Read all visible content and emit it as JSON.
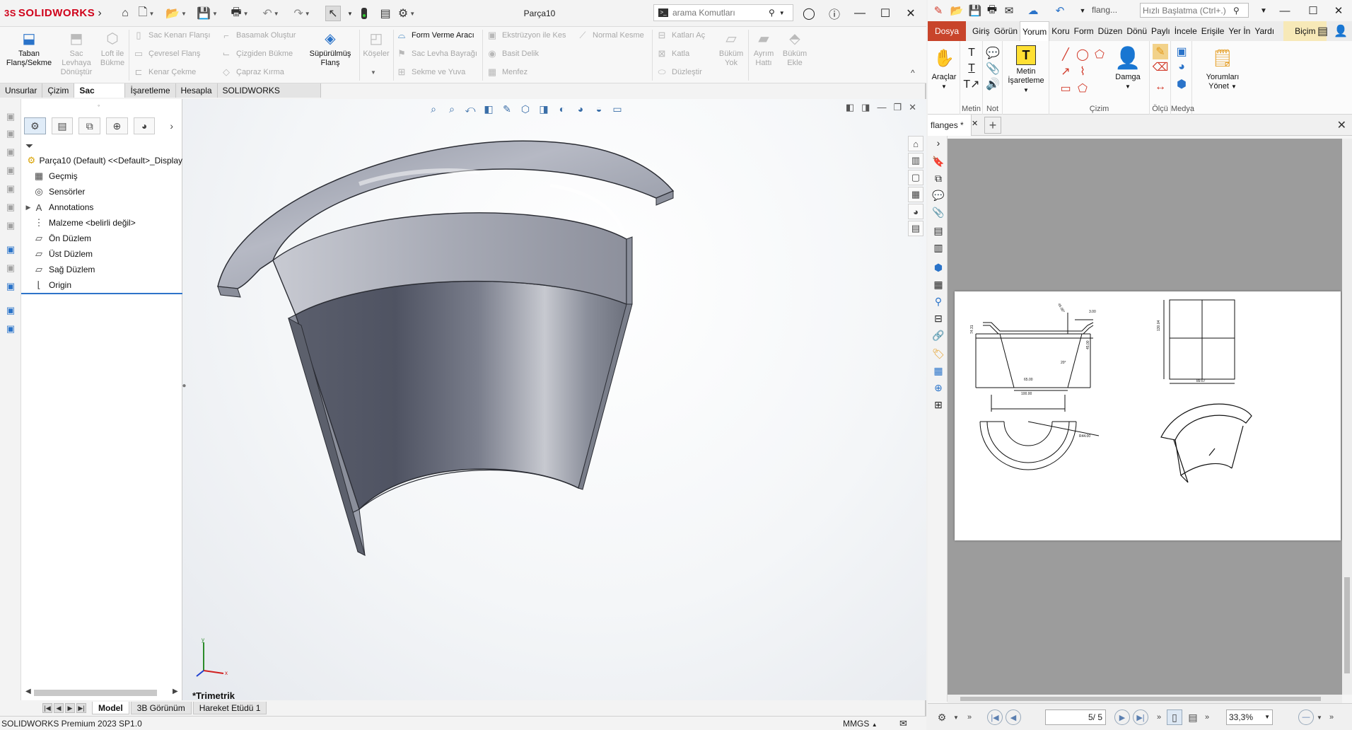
{
  "sw": {
    "logo": "SOLIDWORKS",
    "logo_mark": "3S",
    "doc_title": "Parça10",
    "search_placeholder": "arama Komutları",
    "ribbon": {
      "base_flange": "Taban Flanş/Sekme",
      "sheet_metal": "Sac Levhaya Dönüştür",
      "lofted_bend": "Loft ile Bükme",
      "edge_flange": "Sac Kenarı Flanşı",
      "miter_flange": "Çevresel Flanş",
      "hem": "Kenar Çekme",
      "jog": "Basamak Oluştur",
      "sketched_bend": "Çizgiden Bükme",
      "cross_break": "Çapraz Kırma",
      "swept_flange": "Süpürülmüş Flanş",
      "corners": "Köşeler",
      "forming_tool": "Form Verme Aracı",
      "tab_slot": "Sac Levha Bayrağı",
      "vent": "Sekme ve Yuva",
      "extruded_cut": "Ekstrüzyon ile Kes",
      "simple_hole": "Basit Delik",
      "vent2": "Menfez",
      "normal_cut": "Normal Kesme",
      "unfold": "Katları Aç",
      "fold": "Katla",
      "flatten": "Düzleştir",
      "no_bends": "Büküm Yok",
      "rip": "Ayrım Hattı",
      "insert_bends": "Büküm Ekle"
    },
    "tabs": [
      "Unsurlar",
      "Çizim",
      "Sac Levha",
      "İşaretleme",
      "Hesapla",
      "SOLIDWORKS Eklentileri"
    ],
    "active_tab": "Sac Levha",
    "tree": {
      "root": "Parça10 (Default) <<Default>_Display",
      "items": [
        "Geçmiş",
        "Sensörler",
        "Annotations",
        "Malzeme <belirli değil>",
        "Ön Düzlem",
        "Üst Düzlem",
        "Sağ Düzlem",
        "Origin"
      ]
    },
    "view_label": "*Trimetrik",
    "bottom_tabs": [
      "Model",
      "3B Görünüm",
      "Hareket Etüdü 1"
    ],
    "active_bottom_tab": "Model",
    "status_product": "SOLIDWORKS Premium 2023 SP1.0",
    "status_units": "MMGS",
    "units_arrow": "▲",
    "triad": {
      "x": "x",
      "y": "y"
    }
  },
  "pdf": {
    "file_short": "flang...",
    "search_placeholder": "Hızlı Başlatma (Ctrl+.)",
    "tabs": [
      "Dosya",
      "Giriş",
      "Görün",
      "Yorum",
      "Koru",
      "Form",
      "Düzen",
      "Dönü",
      "Paylı",
      "İncele",
      "Erişile",
      "Yer İn",
      "Yardı",
      "Biçim"
    ],
    "active_tab": "Yorum",
    "ribbon": {
      "tools": "Araçlar",
      "text_group": "Metin",
      "note_group": "Not",
      "text_markup": "Metin İşaretleme",
      "stamp": "Damga",
      "drawing_group": "Çizim",
      "measure_group": "Ölçü",
      "media_group": "Medya",
      "manage_comments": "Yorumları Yönet"
    },
    "doc_tab": "flanges *",
    "page_input": "5",
    "page_total": "/ 5",
    "zoom": "33,3%",
    "drawing": {
      "dim_thickness": "3.00",
      "dim_angle": "45.00°",
      "dim_height_left": "74.31",
      "dim_height_right": "45.00",
      "dim_bottom": "65.00",
      "dim_base": "100.00",
      "dim_side_height": "130.04",
      "dim_side_width": "89.67",
      "dim_radius": "R44.00",
      "dim_angle_small": "20°"
    }
  },
  "colors": {
    "sw_red": "#d0021b",
    "pdf_file_tab": "#c8442b",
    "part_steel": "#6e7384",
    "selection_blue": "#2e74c9"
  }
}
